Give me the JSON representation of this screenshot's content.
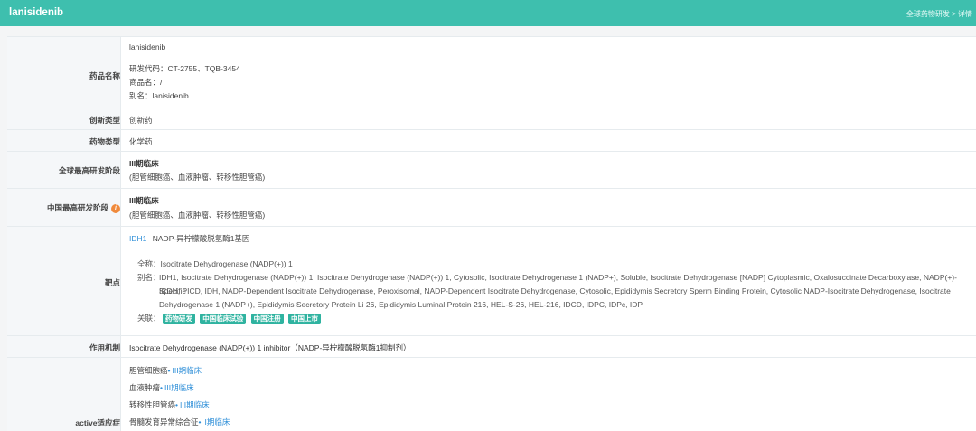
{
  "header": {
    "title": "lanisidenib",
    "breadcrumb": "全球药物研发 > 详情"
  },
  "drug_name": {
    "label": "药品名称",
    "name": "lanisidenib",
    "codes": "研发代码：CT-2755、TQB-3454",
    "trade_name": "商品名：/",
    "alias": "别名：lanisidenib"
  },
  "innovation_type": {
    "label": "创新类型",
    "value": "创新药"
  },
  "drug_type": {
    "label": "药物类型",
    "value": "化学药"
  },
  "global_stage": {
    "label": "全球最高研发阶段",
    "phase": "III期临床",
    "indications": "(胆管细胞癌、血液肿瘤、转移性胆管癌)"
  },
  "china_stage": {
    "label": "中国最高研发阶段",
    "info_icon": "info-icon",
    "phase": "III期临床",
    "indications": "(胆管细胞癌、血液肿瘤、转移性胆管癌)"
  },
  "target": {
    "label": "靶点",
    "gene": "IDH1",
    "gene_desc": "NADP-异柠檬酸脱氢酶1基因",
    "full_name": "全称：Isocitrate Dehydrogenase (NADP(+)) 1",
    "alias_label": "别名：",
    "alias_lines": [
      "IDH1, Isocitrate Dehydrogenase (NADP(+)) 1, Isocitrate Dehydrogenase (NADP(+)) 1, Cytosolic, Isocitrate Dehydrogenase 1 (NADP+), Soluble, Isocitrate Dehydrogenase [NADP] Cytoplasmic, Oxalosuccinate Decarboxylase, NADP(+)-Specific",
      "ICDH, PICD, IDH, NADP-Dependent Isocitrate Dehydrogenase, Peroxisomal, NADP-Dependent Isocitrate Dehydrogenase, Cytosolic, Epididymis Secretory Sperm Binding Protein, Cytosolic NADP-Isocitrate Dehydrogenase, Isocitrate",
      "Dehydrogenase 1 (NADP+), Epididymis Secretory Protein Li 26, Epididymis Luminal Protein 216, HEL-S-26, HEL-216, IDCD, IDPC, IDPc, IDP"
    ],
    "related_label": "关联：",
    "related_tags": [
      "药物研发",
      "中国临床试验",
      "中国注册",
      "中国上市"
    ],
    "tag_color": "#2fb3a0"
  },
  "mechanism": {
    "label": "作用机制",
    "value": "Isocitrate Dehydrogenase (NADP(+)) 1 inhibitor（NADP-异柠檬酸脱氢酶1抑制剂）"
  },
  "indications": {
    "label": "active适应症",
    "items": [
      {
        "name": "胆管细胞癌",
        "sep": "•",
        "phase": "III期临床"
      },
      {
        "name": "血液肿瘤",
        "sep": "•",
        "phase": "III期临床"
      },
      {
        "name": "转移性胆管癌",
        "sep": "•",
        "phase": "III期临床"
      },
      {
        "name": "骨髓发育异常综合征",
        "sep": "•",
        "phase": "I期临床"
      }
    ]
  },
  "colors": {
    "header_bg": "#3ebfae",
    "link": "#2f8fd8",
    "label_bg": "#f5f7f9",
    "info_icon": "#f08a3c"
  }
}
